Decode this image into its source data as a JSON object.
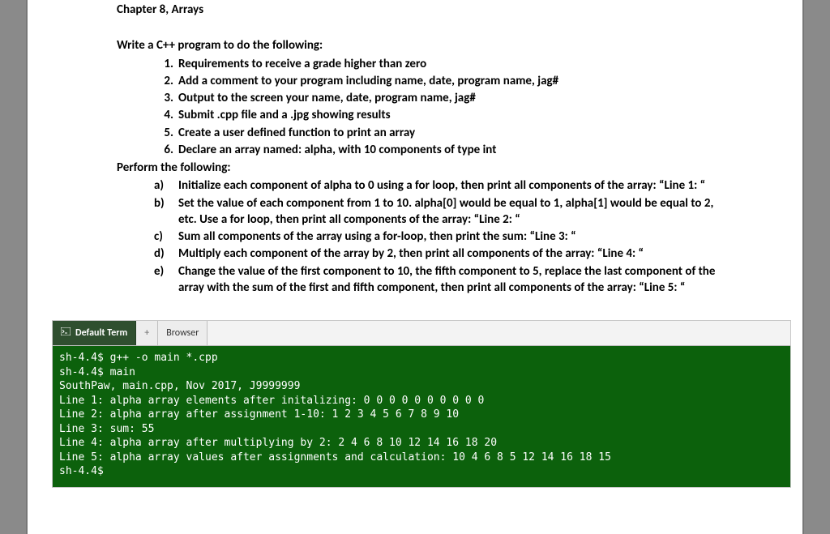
{
  "chapter": "Chapter 8, Arrays",
  "intro": "Write a C++ program to do the following:",
  "numbered": [
    "Requirements to receive a grade higher than zero",
    "Add a comment to your program including name, date, program name, jag#",
    "Output to the screen your name, date, program name, jag#",
    "Submit .cpp file and a .jpg showing results",
    "Create a user defined function to print an array",
    "Declare an array named: alpha, with 10 components of type int"
  ],
  "performHeading": "Perform the following:",
  "lettered": [
    "Initialize each component of alpha to 0 using a for loop, then print all components of the array: “Line 1: “",
    "Set the value of each component from 1 to 10. alpha[0] would be equal to 1, alpha[1] would be equal to 2, etc. Use a for loop, then print all components of the array: “Line 2: “",
    "Sum all components of the array using a for-loop, then print the sum: “Line 3: “",
    "Multiply each component of the array by 2, then print all components of the array: “Line 4: “",
    "Change the value of the first component to 10, the fifth component to 5, replace the last component of the array with the sum of the first and fifth component, then print all components of the array: “Line 5: “"
  ],
  "tabs": {
    "active": "Default Term",
    "browser": "Browser",
    "add": "+"
  },
  "terminal": {
    "lines": [
      "sh-4.4$ g++ -o main *.cpp",
      "sh-4.4$ main",
      "SouthPaw, main.cpp, Nov 2017, J9999999",
      "Line 1: alpha array elements after initalizing: 0 0 0 0 0 0 0 0 0 0",
      "Line 2: alpha array after assignment 1-10: 1 2 3 4 5 6 7 8 9 10",
      "Line 3: sum: 55",
      "Line 4: alpha array after multiplying by 2: 2 4 6 8 10 12 14 16 18 20",
      "Line 5: alpha array values after assignments and calculation: 10 4 6 8 5 12 14 16 18 15",
      "sh-4.4$"
    ]
  }
}
